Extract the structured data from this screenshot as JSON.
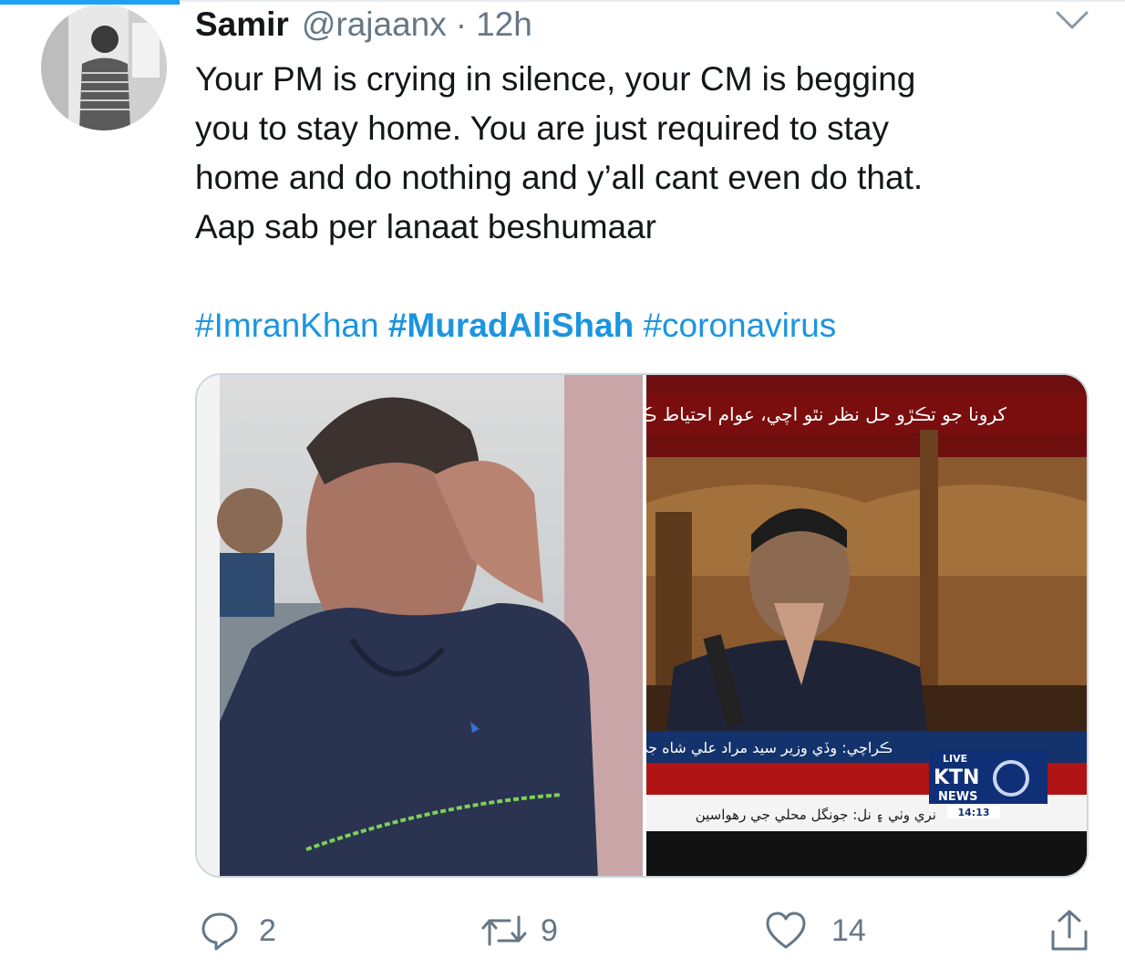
{
  "tweet": {
    "name": "Samir",
    "handle": "@rajaanx",
    "separator": "·",
    "time": "12h",
    "text_lines": [
      "Your PM is crying in silence, your CM is begging",
      "you to stay home. You are just required to stay",
      "home and do nothing and y’all cant even do that.",
      "Aap sab per lanaat beshumaar"
    ],
    "hashtags": [
      "#ImranKhan",
      "#MuradAliShah",
      "#coronavirus"
    ]
  },
  "media": {
    "right": {
      "ticker_top": "كرونا جو تڪڙو حل نظر نٿو اچي، عوام احتياط ڪ",
      "lower_third": "ڪراچي: وڏي وزير سيد مراد علي شاه جي",
      "ticker_bottom": "نري وٺي ۽ نل: جونگل محلي جي رهواسين",
      "channel_live": "LIVE",
      "channel_name": "KTN",
      "channel_news": "NEWS",
      "clock": "14:13"
    }
  },
  "actions": {
    "replies": "2",
    "retweets": "9",
    "likes": "14"
  },
  "colors": {
    "link": "#1b95e0",
    "muted": "#657786",
    "text": "#14171a",
    "accent": "#1da1f2"
  },
  "icons": {
    "more": "chevron-down-icon",
    "reply": "reply-icon",
    "retweet": "retweet-icon",
    "like": "heart-icon",
    "share": "share-icon"
  }
}
